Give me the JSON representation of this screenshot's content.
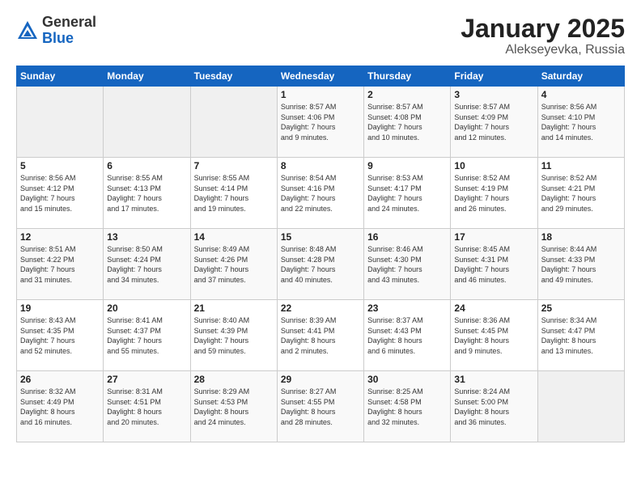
{
  "header": {
    "logo_general": "General",
    "logo_blue": "Blue",
    "month_title": "January 2025",
    "location": "Alekseyevka, Russia"
  },
  "days_of_week": [
    "Sunday",
    "Monday",
    "Tuesday",
    "Wednesday",
    "Thursday",
    "Friday",
    "Saturday"
  ],
  "weeks": [
    [
      {
        "day": "",
        "info": ""
      },
      {
        "day": "",
        "info": ""
      },
      {
        "day": "",
        "info": ""
      },
      {
        "day": "1",
        "info": "Sunrise: 8:57 AM\nSunset: 4:06 PM\nDaylight: 7 hours\nand 9 minutes."
      },
      {
        "day": "2",
        "info": "Sunrise: 8:57 AM\nSunset: 4:08 PM\nDaylight: 7 hours\nand 10 minutes."
      },
      {
        "day": "3",
        "info": "Sunrise: 8:57 AM\nSunset: 4:09 PM\nDaylight: 7 hours\nand 12 minutes."
      },
      {
        "day": "4",
        "info": "Sunrise: 8:56 AM\nSunset: 4:10 PM\nDaylight: 7 hours\nand 14 minutes."
      }
    ],
    [
      {
        "day": "5",
        "info": "Sunrise: 8:56 AM\nSunset: 4:12 PM\nDaylight: 7 hours\nand 15 minutes."
      },
      {
        "day": "6",
        "info": "Sunrise: 8:55 AM\nSunset: 4:13 PM\nDaylight: 7 hours\nand 17 minutes."
      },
      {
        "day": "7",
        "info": "Sunrise: 8:55 AM\nSunset: 4:14 PM\nDaylight: 7 hours\nand 19 minutes."
      },
      {
        "day": "8",
        "info": "Sunrise: 8:54 AM\nSunset: 4:16 PM\nDaylight: 7 hours\nand 22 minutes."
      },
      {
        "day": "9",
        "info": "Sunrise: 8:53 AM\nSunset: 4:17 PM\nDaylight: 7 hours\nand 24 minutes."
      },
      {
        "day": "10",
        "info": "Sunrise: 8:52 AM\nSunset: 4:19 PM\nDaylight: 7 hours\nand 26 minutes."
      },
      {
        "day": "11",
        "info": "Sunrise: 8:52 AM\nSunset: 4:21 PM\nDaylight: 7 hours\nand 29 minutes."
      }
    ],
    [
      {
        "day": "12",
        "info": "Sunrise: 8:51 AM\nSunset: 4:22 PM\nDaylight: 7 hours\nand 31 minutes."
      },
      {
        "day": "13",
        "info": "Sunrise: 8:50 AM\nSunset: 4:24 PM\nDaylight: 7 hours\nand 34 minutes."
      },
      {
        "day": "14",
        "info": "Sunrise: 8:49 AM\nSunset: 4:26 PM\nDaylight: 7 hours\nand 37 minutes."
      },
      {
        "day": "15",
        "info": "Sunrise: 8:48 AM\nSunset: 4:28 PM\nDaylight: 7 hours\nand 40 minutes."
      },
      {
        "day": "16",
        "info": "Sunrise: 8:46 AM\nSunset: 4:30 PM\nDaylight: 7 hours\nand 43 minutes."
      },
      {
        "day": "17",
        "info": "Sunrise: 8:45 AM\nSunset: 4:31 PM\nDaylight: 7 hours\nand 46 minutes."
      },
      {
        "day": "18",
        "info": "Sunrise: 8:44 AM\nSunset: 4:33 PM\nDaylight: 7 hours\nand 49 minutes."
      }
    ],
    [
      {
        "day": "19",
        "info": "Sunrise: 8:43 AM\nSunset: 4:35 PM\nDaylight: 7 hours\nand 52 minutes."
      },
      {
        "day": "20",
        "info": "Sunrise: 8:41 AM\nSunset: 4:37 PM\nDaylight: 7 hours\nand 55 minutes."
      },
      {
        "day": "21",
        "info": "Sunrise: 8:40 AM\nSunset: 4:39 PM\nDaylight: 7 hours\nand 59 minutes."
      },
      {
        "day": "22",
        "info": "Sunrise: 8:39 AM\nSunset: 4:41 PM\nDaylight: 8 hours\nand 2 minutes."
      },
      {
        "day": "23",
        "info": "Sunrise: 8:37 AM\nSunset: 4:43 PM\nDaylight: 8 hours\nand 6 minutes."
      },
      {
        "day": "24",
        "info": "Sunrise: 8:36 AM\nSunset: 4:45 PM\nDaylight: 8 hours\nand 9 minutes."
      },
      {
        "day": "25",
        "info": "Sunrise: 8:34 AM\nSunset: 4:47 PM\nDaylight: 8 hours\nand 13 minutes."
      }
    ],
    [
      {
        "day": "26",
        "info": "Sunrise: 8:32 AM\nSunset: 4:49 PM\nDaylight: 8 hours\nand 16 minutes."
      },
      {
        "day": "27",
        "info": "Sunrise: 8:31 AM\nSunset: 4:51 PM\nDaylight: 8 hours\nand 20 minutes."
      },
      {
        "day": "28",
        "info": "Sunrise: 8:29 AM\nSunset: 4:53 PM\nDaylight: 8 hours\nand 24 minutes."
      },
      {
        "day": "29",
        "info": "Sunrise: 8:27 AM\nSunset: 4:55 PM\nDaylight: 8 hours\nand 28 minutes."
      },
      {
        "day": "30",
        "info": "Sunrise: 8:25 AM\nSunset: 4:58 PM\nDaylight: 8 hours\nand 32 minutes."
      },
      {
        "day": "31",
        "info": "Sunrise: 8:24 AM\nSunset: 5:00 PM\nDaylight: 8 hours\nand 36 minutes."
      },
      {
        "day": "",
        "info": ""
      }
    ]
  ]
}
